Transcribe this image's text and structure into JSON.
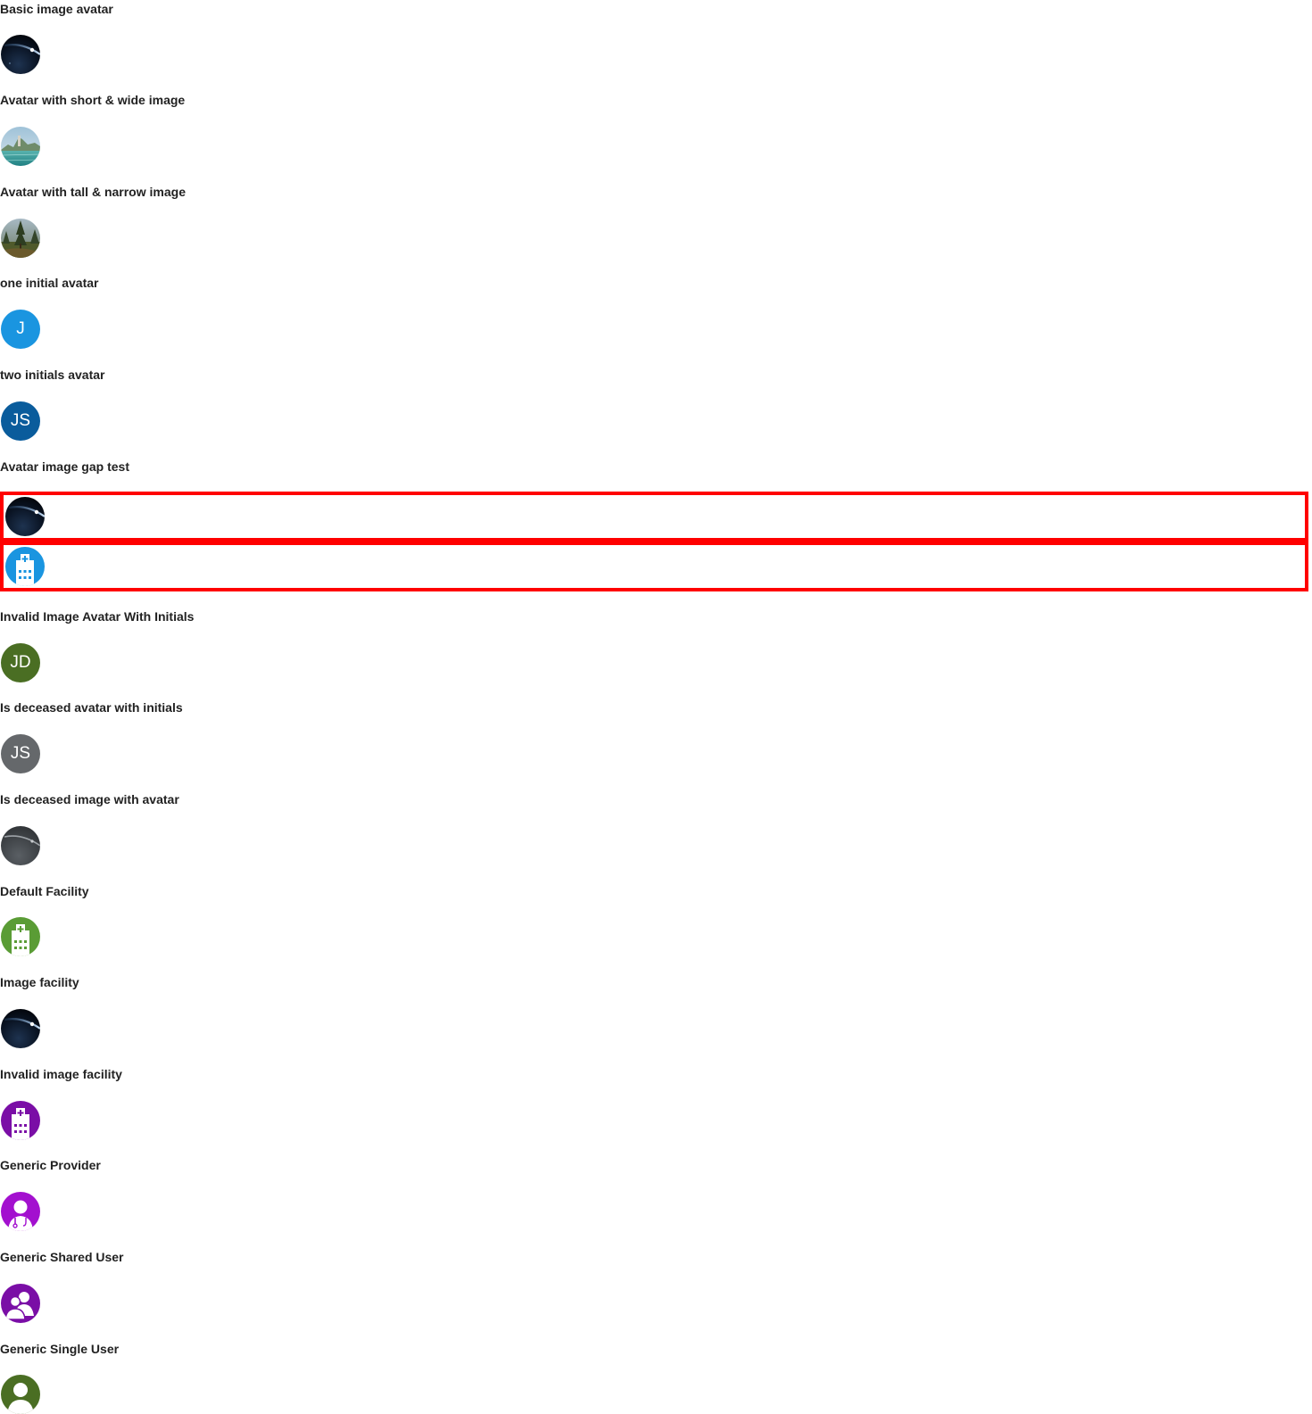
{
  "sections": [
    {
      "label": "Basic image avatar",
      "avatar": {
        "kind": "image",
        "image": "space"
      }
    },
    {
      "label": "Avatar with short & wide image",
      "avatar": {
        "kind": "image",
        "image": "lake"
      }
    },
    {
      "label": "Avatar with tall & narrow image",
      "avatar": {
        "kind": "image",
        "image": "forest"
      }
    },
    {
      "label": "one initial avatar",
      "avatar": {
        "kind": "initials",
        "initials": "J",
        "color": "#1a95e0"
      }
    },
    {
      "label": "two initials avatar",
      "avatar": {
        "kind": "initials",
        "initials": "JS",
        "color": "#0a5c9c"
      }
    },
    {
      "label": "Avatar image gap test",
      "gap_items": [
        {
          "kind": "image",
          "image": "space"
        },
        {
          "kind": "icon",
          "icon": "facility-icon",
          "color": "#1a95e0"
        }
      ]
    },
    {
      "label": "Invalid Image Avatar With Initials",
      "avatar": {
        "kind": "initials",
        "initials": "JD",
        "color": "#4a6e23"
      }
    },
    {
      "label": "Is deceased avatar with initials",
      "avatar": {
        "kind": "initials",
        "initials": "JS",
        "color": "#65686b"
      }
    },
    {
      "label": "Is deceased image with avatar",
      "avatar": {
        "kind": "image",
        "image": "space-deceased"
      }
    },
    {
      "label": "Default Facility",
      "avatar": {
        "kind": "icon",
        "icon": "facility-icon",
        "color": "#5a9c35"
      }
    },
    {
      "label": "Image facility",
      "avatar": {
        "kind": "image",
        "image": "space"
      }
    },
    {
      "label": "Invalid image facility",
      "avatar": {
        "kind": "icon",
        "icon": "facility-icon",
        "color": "#7a0ea6"
      }
    },
    {
      "label": "Generic Provider",
      "avatar": {
        "kind": "icon",
        "icon": "provider-icon",
        "color": "#a310cf"
      }
    },
    {
      "label": "Generic Shared User",
      "avatar": {
        "kind": "icon",
        "icon": "shared-user-icon",
        "color": "#7a0ea6"
      }
    },
    {
      "label": "Generic Single User",
      "avatar": {
        "kind": "icon",
        "icon": "single-user-icon",
        "color": "#4a6e23"
      }
    }
  ]
}
